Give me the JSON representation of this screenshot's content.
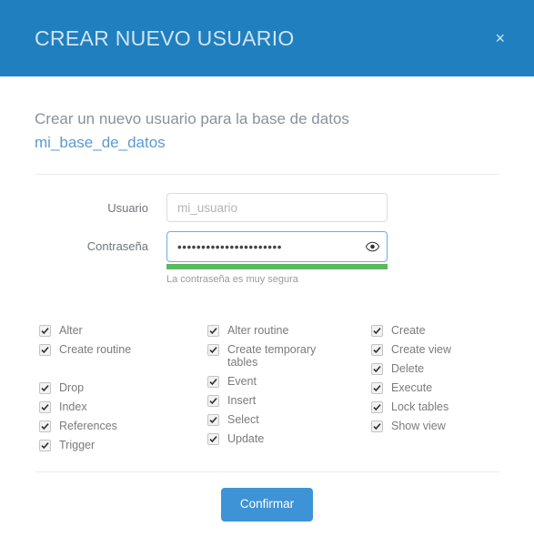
{
  "header": {
    "title": "CREAR NUEVO USUARIO",
    "close_label": "×",
    "bg_color": "#1f7fbf",
    "title_color": "#cfe4f2"
  },
  "body": {
    "description_prefix": "Crear un nuevo usuario para la base de datos",
    "database_name": "mi_base_de_datos",
    "database_name_color": "#5b9bd1"
  },
  "form": {
    "username": {
      "label": "Usuario",
      "placeholder": "mi_usuario",
      "value": ""
    },
    "password": {
      "label": "Contraseña",
      "value": "••••••••••••••••••••••",
      "toggle_icon": "eye-icon",
      "strength_text": "La contraseña es muy segura",
      "strength_percent": 100,
      "strength_color": "#5cb85c"
    }
  },
  "privileges": {
    "columns": [
      {
        "items": [
          {
            "label": "Alter",
            "checked": true
          },
          {
            "label": "Create routine",
            "checked": true
          },
          {
            "label": "",
            "checked": false,
            "spacer": true
          },
          {
            "label": "Drop",
            "checked": true
          },
          {
            "label": "Index",
            "checked": true
          },
          {
            "label": "References",
            "checked": true
          },
          {
            "label": "Trigger",
            "checked": true
          }
        ]
      },
      {
        "items": [
          {
            "label": "Alter routine",
            "checked": true
          },
          {
            "label": "Create temporary tables",
            "checked": true
          },
          {
            "label": "Event",
            "checked": true
          },
          {
            "label": "Insert",
            "checked": true
          },
          {
            "label": "Select",
            "checked": true
          },
          {
            "label": "Update",
            "checked": true
          }
        ]
      },
      {
        "items": [
          {
            "label": "Create",
            "checked": true
          },
          {
            "label": "Create view",
            "checked": true
          },
          {
            "label": "Delete",
            "checked": true
          },
          {
            "label": "Execute",
            "checked": true
          },
          {
            "label": "Lock tables",
            "checked": true
          },
          {
            "label": "Show view",
            "checked": true
          }
        ]
      }
    ]
  },
  "footer": {
    "confirm_label": "Confirmar",
    "confirm_color": "#3d93d6"
  }
}
